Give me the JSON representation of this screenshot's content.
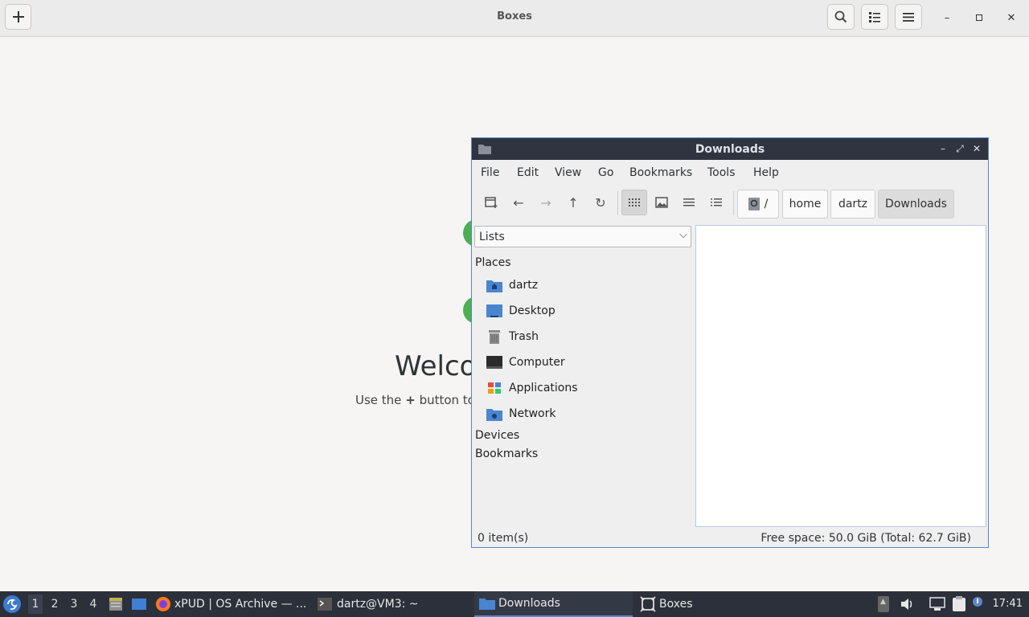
{
  "boxes": {
    "title": "Boxes",
    "welcome_heading": "Welco",
    "welcome_prefix": "Use the",
    "welcome_plus": "+",
    "welcome_suffix": "button to"
  },
  "fm": {
    "title": "Downloads",
    "menu": [
      "File",
      "Edit",
      "View",
      "Go",
      "Bookmarks",
      "Tools",
      "Help"
    ],
    "path": {
      "root": "/",
      "parts": [
        "home",
        "dartz",
        "Downloads"
      ]
    },
    "side_selector": "Lists",
    "places_label": "Places",
    "places": [
      "dartz",
      "Desktop",
      "Trash",
      "Computer",
      "Applications",
      "Network"
    ],
    "devices_label": "Devices",
    "bookmarks_label": "Bookmarks",
    "status_items": "0 item(s)",
    "status_space": "Free space: 50.0 GiB (Total: 62.7 GiB)"
  },
  "taskbar": {
    "workspaces": [
      "1",
      "2",
      "3",
      "4"
    ],
    "tasks": [
      "xPUD | OS Archive — ...",
      "dartz@VM3: ~",
      "Downloads",
      "Boxes"
    ],
    "clock": "17:41"
  },
  "colors": {
    "accent": "#5b87c9",
    "titlebar": "#2f3440",
    "taskbar": "#2c303a",
    "folder": "#4a86cf"
  }
}
